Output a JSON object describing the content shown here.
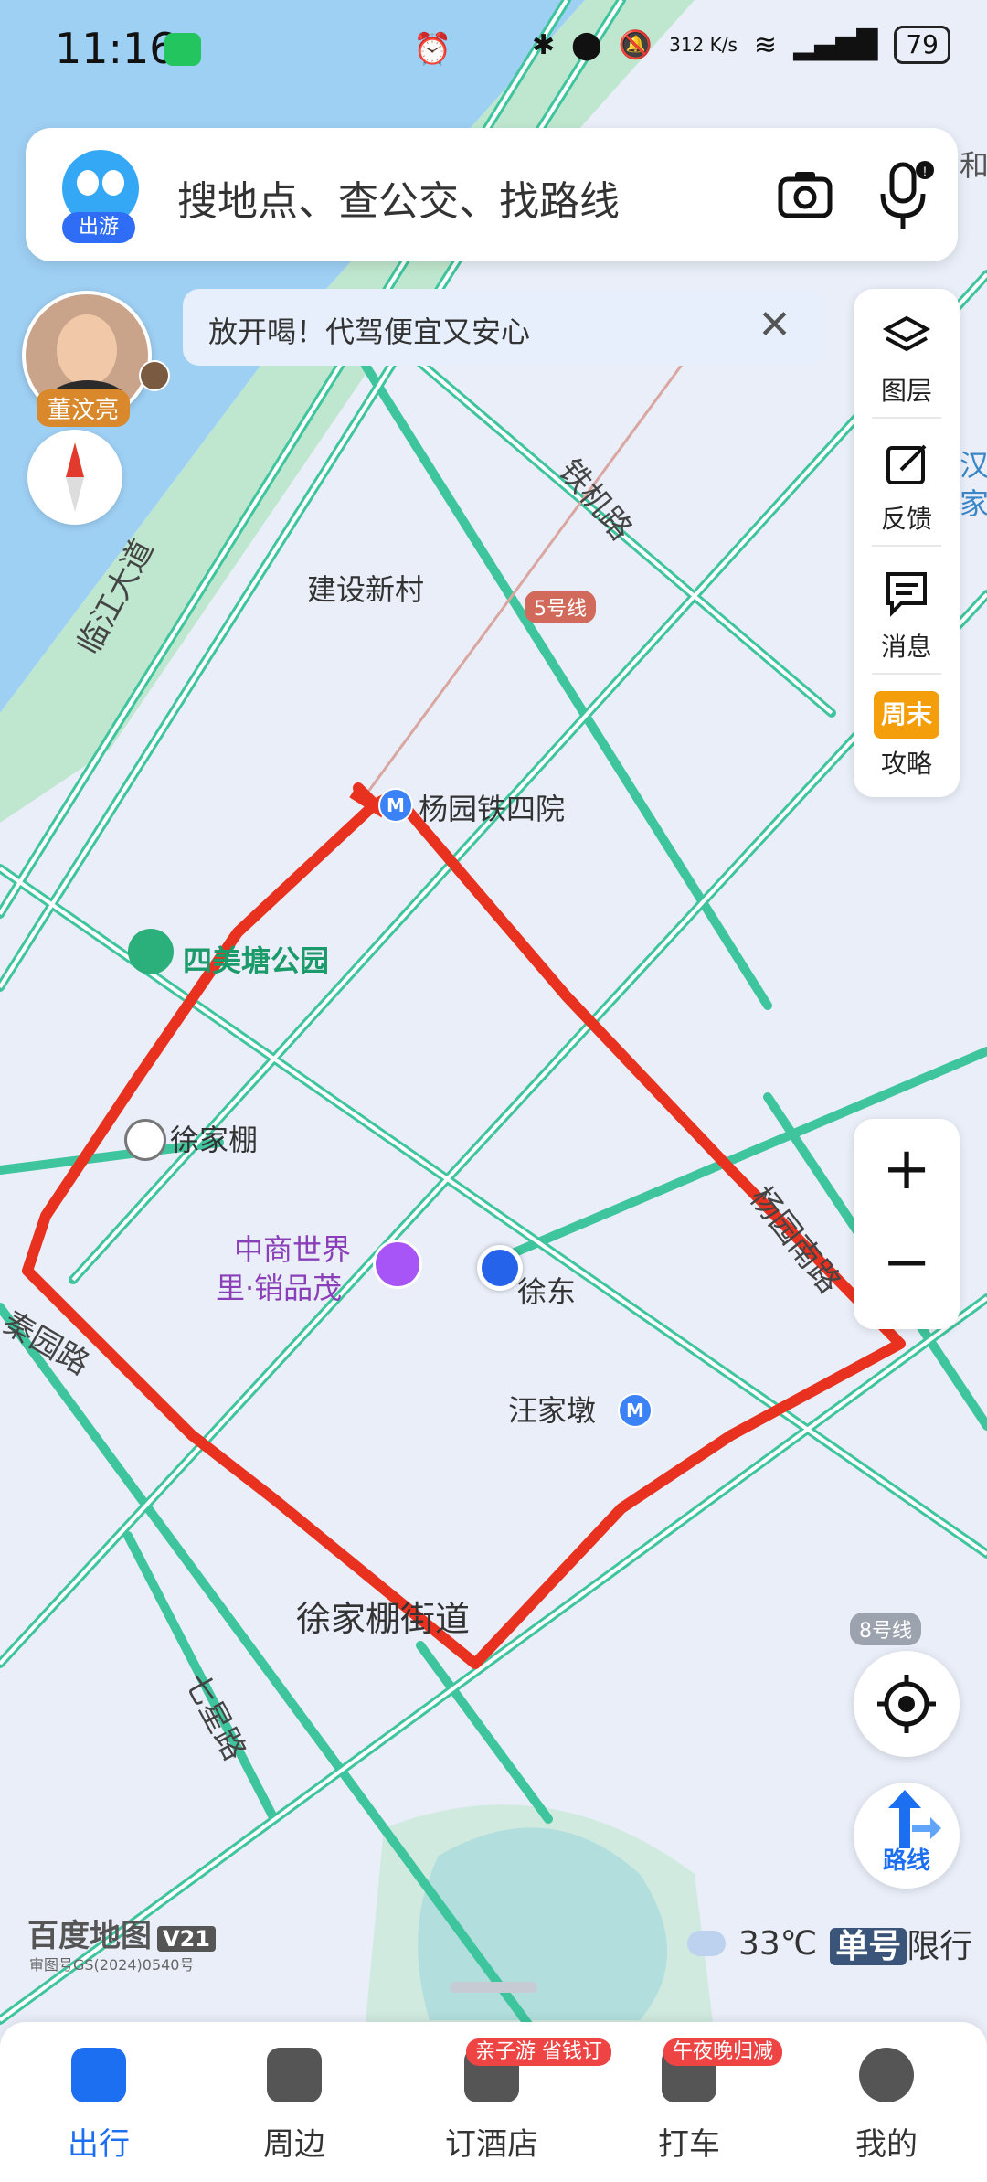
{
  "status_bar": {
    "time": "11:16",
    "net_speed": "312 K/s",
    "battery": "79"
  },
  "search": {
    "placeholder": "搜地点、查公交、找路线",
    "avatar_tag": "出游"
  },
  "banner": {
    "text": "放开喝！代驾便宜又安心",
    "close": "✕"
  },
  "celebrity": {
    "name": "董汶亮"
  },
  "tools": [
    {
      "label": "图层",
      "icon": "layers-icon"
    },
    {
      "label": "反馈",
      "icon": "feedback-icon"
    },
    {
      "label": "消息",
      "icon": "message-icon"
    },
    {
      "label": "攻略",
      "badge": "周末",
      "icon": "weekend-guide-icon"
    }
  ],
  "zoom": {
    "plus": "+",
    "minus": "−"
  },
  "route_button": {
    "label": "路线"
  },
  "map": {
    "labels": {
      "jianshe": "建设新村",
      "yangyuan_metro": "杨园铁四院",
      "simei_park": "四美塘公园",
      "xujiapeng": "徐家棚",
      "mall_line1": "中商世界",
      "mall_line2": "里·销品茂",
      "xudong": "徐东",
      "wangjiadun": "汪家墩",
      "street": "徐家棚街道",
      "top_right_edge1": "和",
      "top_right_edge2": "汉",
      "top_right_edge3": "家"
    },
    "roads": {
      "linjiang": "临江大道",
      "tieji": "铁机路",
      "qinyuan": "秦园路",
      "qixing": "七星路",
      "yangyuan_road": "杨园南路"
    },
    "lines": {
      "line5": "5号线",
      "line8": "8号线"
    },
    "route_color": "#e8321f",
    "road_color": "#3fc59d"
  },
  "branding": {
    "name": "百度地图",
    "version": "V21",
    "approval": "审图号GS(2024)0540号"
  },
  "weather": {
    "temp": "33℃",
    "plate_tag": "单号",
    "restriction": "限行"
  },
  "tabs": [
    {
      "label": "出行",
      "active": true
    },
    {
      "label": "周边"
    },
    {
      "label": "订酒店",
      "promo": "亲子游 省钱订"
    },
    {
      "label": "打车",
      "promo": "午夜晚归减"
    },
    {
      "label": "我的"
    }
  ]
}
